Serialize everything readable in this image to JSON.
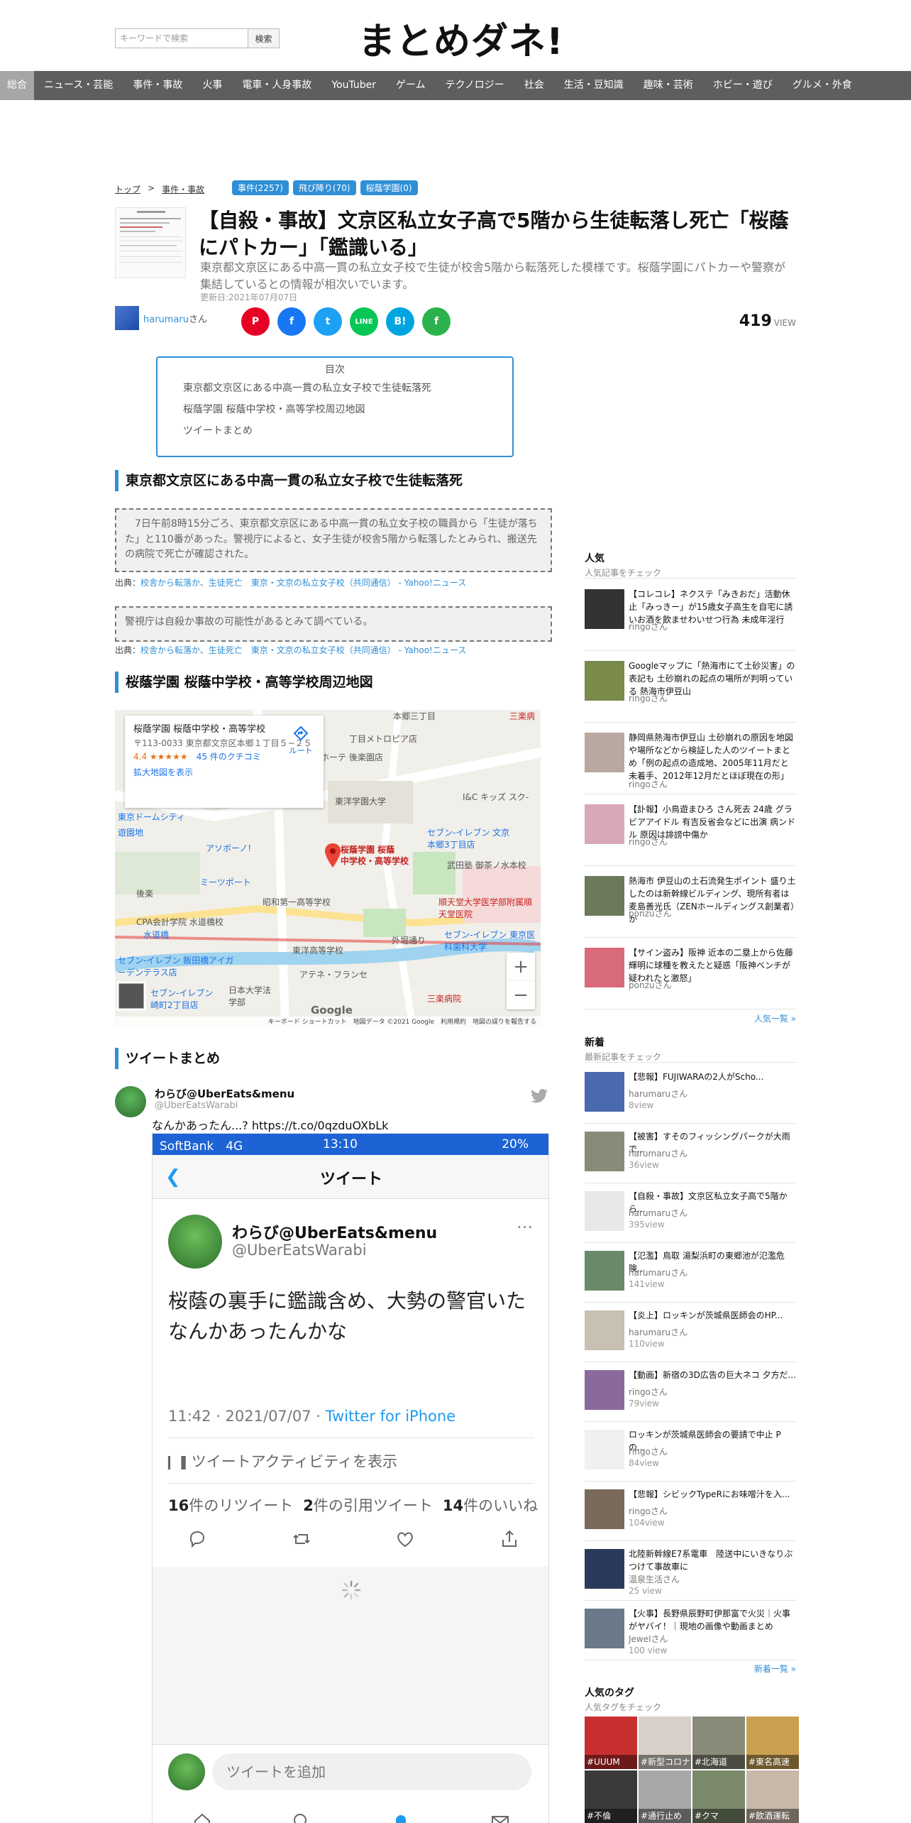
{
  "header": {
    "search_placeholder": "キーワードで検索",
    "search_button": "検索",
    "logo": "まとめダネ!"
  },
  "nav": [
    "総合",
    "ニュース・芸能",
    "事件・事故",
    "火事",
    "電車・人身事故",
    "YouTuber",
    "ゲーム",
    "テクノロジー",
    "社会",
    "生活・豆知識",
    "趣味・芸術",
    "ホビー・遊び",
    "グルメ・外食"
  ],
  "breadcrumb": [
    "トップ",
    "事件・事故"
  ],
  "breadcrumb_sep": ">",
  "article_tags": [
    "事件(2257)",
    "飛び降り(70)",
    "桜蔭学園(0)"
  ],
  "article": {
    "title": "【自殺・事故】文京区私立女子高で5階から生徒転落し死亡「桜蔭にパトカー」「鑑識いる」",
    "lead": "東京都文京区にある中高一貫の私立女子校で生徒が校舎5階から転落死した模様です。桜蔭学園にパトカーや警察が集結しているとの情報が相次いでいます。",
    "updated": "更新日:2021年07月07日",
    "author": "harumaru",
    "author_suffix": "さん",
    "views": "419",
    "views_label": "VIEW"
  },
  "share": [
    {
      "name": "pinterest",
      "glyph": "P",
      "color": "#e60023"
    },
    {
      "name": "facebook",
      "glyph": "f",
      "color": "#1877f2"
    },
    {
      "name": "twitter",
      "glyph": "t",
      "color": "#1da1f2"
    },
    {
      "name": "line",
      "glyph": "LINE",
      "color": "#06c755"
    },
    {
      "name": "hatena",
      "glyph": "B!",
      "color": "#00a4de"
    },
    {
      "name": "feedly",
      "glyph": "f",
      "color": "#2bb24c"
    }
  ],
  "toc": {
    "title": "目次",
    "items": [
      "東京都文京区にある中高一貫の私立女子校で生徒転落死",
      "桜蔭学園 桜蔭中学校・高等学校周辺地図",
      "ツイートまとめ"
    ]
  },
  "sections": {
    "s1": "東京都文京区にある中高一貫の私立女子校で生徒転落死",
    "s2": "桜蔭学園 桜蔭中学校・高等学校周辺地図",
    "s3": "ツイートまとめ"
  },
  "quotes": [
    "　7日午前8時15分ごろ、東京都文京区にある中高一貫の私立女子校の職員から「生徒が落ちた」と110番があった。警視庁によると、女子生徒が校舎5階から転落したとみられ、搬送先の病院で死亡が確認された。",
    "警視庁は自殺か事故の可能性があるとみて調べている。"
  ],
  "source": {
    "label": "出典：",
    "link": "校舎から転落か、生徒死亡　東京・文京の私立女子校（共同通信） - Yahoo!ニュース"
  },
  "map": {
    "card_title": "桜蔭学園 桜蔭中学校・高等学校",
    "card_addr": "〒113-0033 東京都文京区本郷１丁目５−２５",
    "rating": "4.4 ★★★★★",
    "reviews": "45 件のクチコミ",
    "enlarge": "拡大地図を表示",
    "route": "ルート",
    "pin_label": "桜蔭学園 桜蔭\n中学校・高等学校",
    "labels": [
      "本郷三丁目",
      "丁目メトロピア店",
      "ホーテ 後楽園店",
      "東洋学園大学",
      "I&C キッズ スク-",
      "東京ドームシティ",
      "アソボーノ!",
      "セブン-イレブン 文京本郷3丁目店",
      "武田塾 御茶ノ水本校",
      "ミーツポート",
      "後楽",
      "昭和第一高等学校",
      "順天堂大学医学部附属順天堂医院",
      "CPA会計学院 水道橋校",
      "水道橋",
      "セブン-イレブン 東京医科歯科大学",
      "東洋高等学校",
      "外堀通り",
      "セブン-イレブン 飯田橋アイガーデンテラス店",
      "アテネ・フランセ",
      "日本大学法学部",
      "三楽病院",
      "三楽病",
      "遊園地",
      "セブン-イレブン 崎町2丁目店"
    ],
    "google": "Google",
    "attrib": "キーボード ショートカット　地図データ ©2021 Google　利用規約　地図の誤りを報告する",
    "zoom_in": "+",
    "zoom_out": "−"
  },
  "tweet": {
    "user": "わらび@UberEats&menu",
    "handle": "@UberEatsWarabi",
    "text": "なんかあったん...? https://t.co/0qzduOXbLk",
    "image": {
      "carrier": "SoftBank　4G",
      "time": "13:10",
      "battery": "20%",
      "nav_title": "ツイート",
      "user": "わらび@UberEats&menu",
      "handle": "@UberEatsWarabi",
      "text": "桜蔭の裏手に鑑識含め、大勢の警官いた\nなんかあったんかな",
      "meta_time": "11:42 · 2021/07/07 · ",
      "meta_source": "Twitter for iPhone",
      "activity": "ツイートアクティビティを表示",
      "retweets": "16",
      "retweets_label": "件のリツイート",
      "quotes": "2",
      "quotes_label": "件の引用ツイート",
      "likes": "14",
      "likes_label": "件のいいね",
      "reply_placeholder": "ツイートを追加"
    }
  },
  "sidebar": {
    "popular_title": "人気",
    "popular_sub": "人気記事をチェック",
    "popular": [
      {
        "title": "【コレコレ】ネクステ「みきおだ」活動休止「みっきー」が15歳女子高生を自宅に誘いお酒を飲ませわいせつ行為 未成年淫行",
        "author": "ringo",
        "color": "#333"
      },
      {
        "title": "Googleマップに「熱海市にて土砂災害」の表記も 土砂崩れの起点の場所が判明っている 熱海市伊豆山",
        "author": "ringo",
        "color": "#7a8a4a"
      },
      {
        "title": "静岡県熱海市伊豆山 土砂崩れの原因を地図や場所などから検証した人のツイートまとめ「例の起点の造成地、2005年11月だと未着手、2012年12月だとほぼ現在の形」",
        "author": "ringo",
        "color": "#b8a8a0"
      },
      {
        "title": "【訃報】小鳥遊まひろ さん死去 24歳 グラビアアイドル 有吉反省会などに出演 病ンドル 原因は誹謗中傷か",
        "author": "ringo",
        "color": "#d8a8b8"
      },
      {
        "title": "熱海市 伊豆山の土石流発生ポイント 盛り土したのは新幹線ビルディング、現所有者は麦島善光氏（ZENホールディングス創業者）か",
        "author": "ponzu",
        "color": "#6a7a5a"
      },
      {
        "title": "【サイン盗み】阪神 近本の二塁上から佐藤輝明に球種を教えたと疑惑「阪神ベンチが疑われたと激怒」",
        "author": "ponzu",
        "color": "#d86a7a"
      }
    ],
    "popular_more": "人気一覧 »",
    "new_title": "新着",
    "new_sub": "最新記事をチェック",
    "new": [
      {
        "title": "【悲報】FUJIWARAの2人がScho...",
        "author": "harumaru",
        "views": "8view",
        "color": "#4a6ab0"
      },
      {
        "title": "【被害】すそのフィッシングパークが大雨で...",
        "author": "harumaru",
        "views": "36view",
        "color": "#8a8a7a"
      },
      {
        "title": "【自殺・事故】文京区私立女子高で5階から...",
        "author": "harumaru",
        "views": "395view",
        "color": "#e8e8e8"
      },
      {
        "title": "【氾濫】鳥取 湯梨浜町の東郷池が氾濫危険...",
        "author": "harumaru",
        "views": "141view",
        "color": "#6a8a6a"
      },
      {
        "title": "【炎上】ロッキンが茨城県医師会のHP...",
        "author": "harumaru",
        "views": "110view",
        "color": "#c8c0b0"
      },
      {
        "title": "【動画】新宿の3D広告の巨大ネコ 夕方だ...",
        "author": "ringo",
        "views": "79view",
        "color": "#8a6a9a"
      },
      {
        "title": "ロッキンが茨城県医師会の要請で中止 Pの...",
        "author": "ringo",
        "views": "84view",
        "color": "#f0f0f0"
      },
      {
        "title": "【悲報】シビックTypeRにお味噌汁を入...",
        "author": "ringo",
        "views": "104view",
        "color": "#7a6a5a"
      },
      {
        "title": "北陸新幹線E7系電車　陸送中にいきなりぶつけて事故車に",
        "author": "温泉生活",
        "views": "25 view",
        "color": "#2a3a5a"
      },
      {
        "title": "【火事】長野県辰野町伊那富で火災｜火事がヤバイ！｜現地の画像や動画まとめ",
        "author": "Jewel",
        "views": "100 view",
        "color": "#6a7a8a"
      }
    ],
    "new_more": "新着一覧 »",
    "tags_title": "人気のタグ",
    "tags_sub": "人気タグをチェック",
    "tags": [
      {
        "label": "#UUUM",
        "color": "#c83030"
      },
      {
        "label": "#新型コロナ",
        "color": "#d8d0c8"
      },
      {
        "label": "#北海道",
        "color": "#8a8a7a"
      },
      {
        "label": "#東名高速",
        "color": "#c8a050"
      },
      {
        "label": "#不倫",
        "color": "#3a3a3a"
      },
      {
        "label": "#通行止め",
        "color": "#a8a8a8"
      },
      {
        "label": "#クマ",
        "color": "#7a8a6a"
      },
      {
        "label": "#飲酒運転",
        "color": "#c8b8a8"
      }
    ],
    "author_suffix": "さん"
  }
}
